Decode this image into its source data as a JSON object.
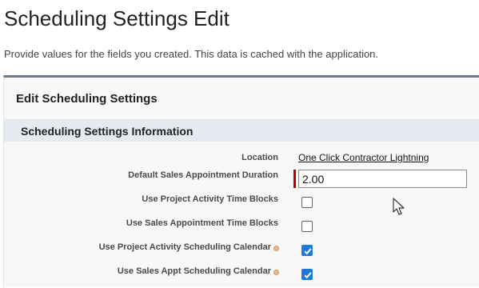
{
  "page": {
    "title": "Scheduling Settings Edit",
    "description": "Provide values for the fields you created. This data is cached with the application."
  },
  "panel": {
    "title": "Edit Scheduling Settings",
    "section_title": "Scheduling Settings Information"
  },
  "fields": {
    "location": {
      "label": "Location",
      "value": "One Click Contractor Lightning"
    },
    "default_duration": {
      "label": "Default Sales Appointment Duration",
      "value": "2.00",
      "required": true
    },
    "project_time_blocks": {
      "label": "Use Project Activity Time Blocks",
      "checked": false
    },
    "sales_time_blocks": {
      "label": "Use Sales Appointment Time Blocks",
      "checked": false
    },
    "project_calendar": {
      "label": "Use Project Activity Scheduling Calendar",
      "checked": true,
      "help_icon": "help-icon"
    },
    "sales_calendar": {
      "label": "Use Sales Appt Scheduling Calendar",
      "checked": true,
      "help_icon": "help-icon"
    }
  },
  "colors": {
    "panel_border": "#6f7a8d",
    "section_bar": "#e5e9f0",
    "required": "#c00000",
    "checkbox_checked": "#1f78d6"
  },
  "cursor_icon": "mouse-pointer-icon"
}
